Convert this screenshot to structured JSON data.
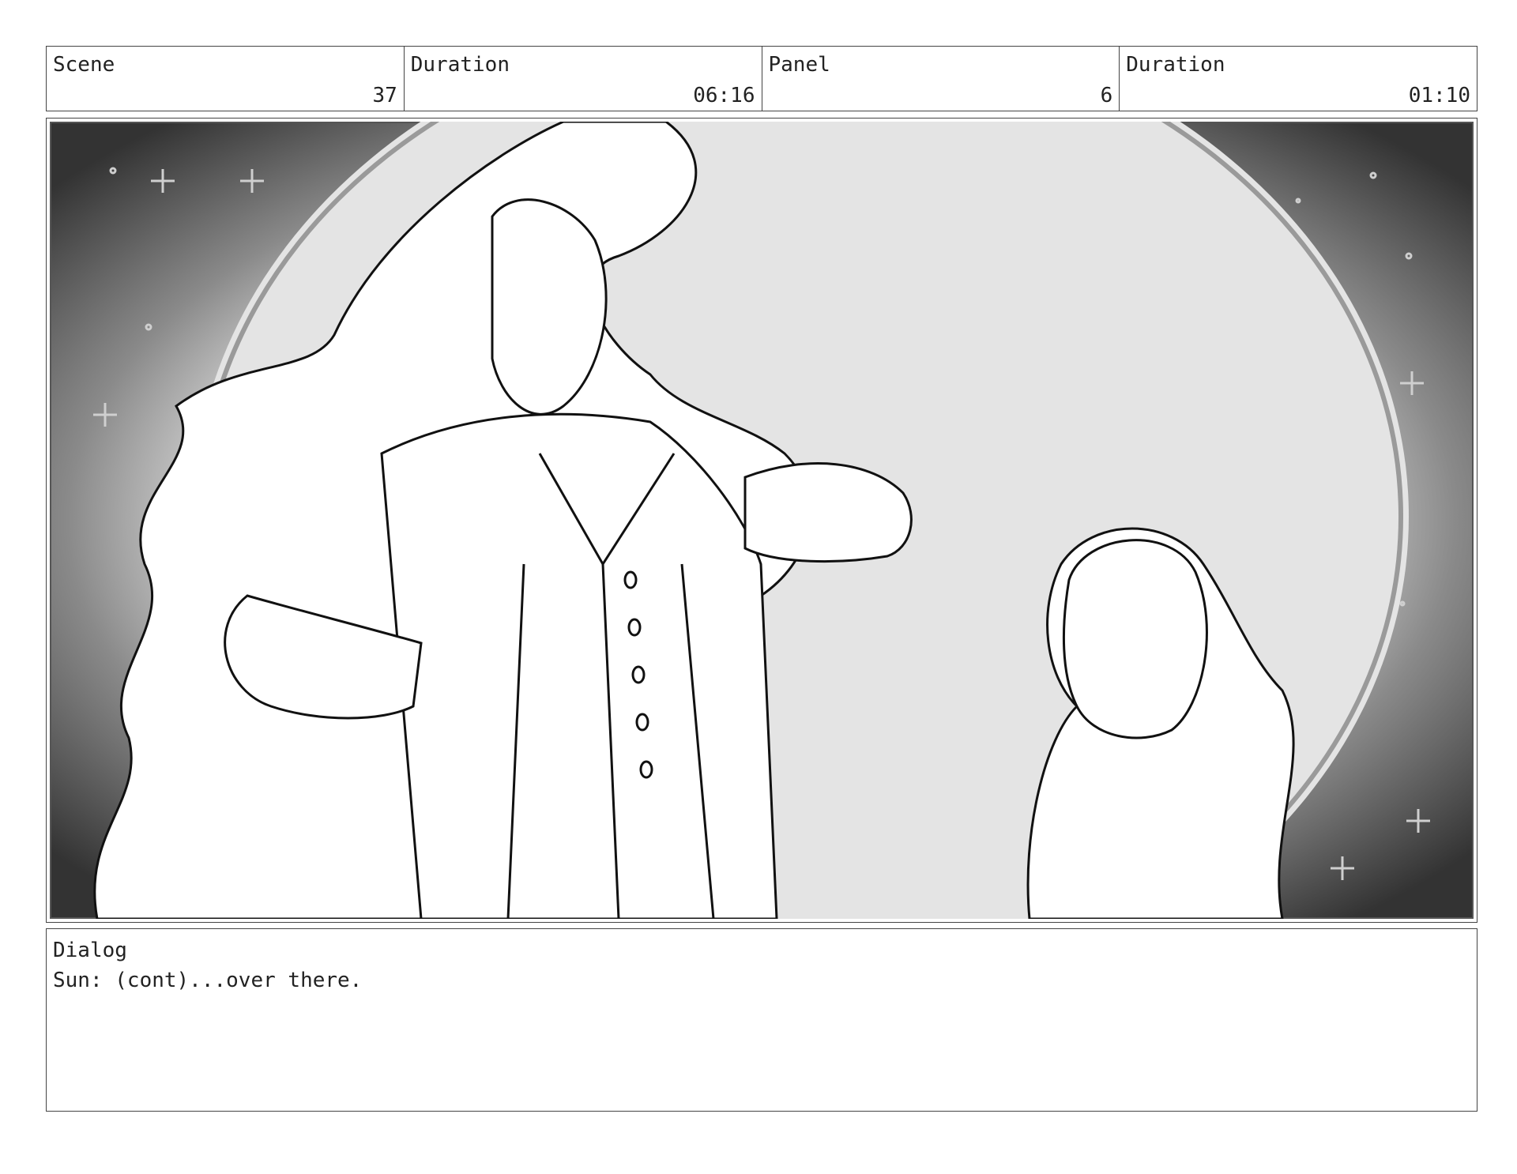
{
  "header": {
    "scene_label": "Scene",
    "scene_value": "37",
    "scene_duration_label": "Duration",
    "scene_duration_value": "06:16",
    "panel_label": "Panel",
    "panel_value": "6",
    "panel_duration_label": "Duration",
    "panel_duration_value": "01:10"
  },
  "dialog": {
    "label": "Dialog",
    "text": "Sun: (cont)...over there."
  }
}
